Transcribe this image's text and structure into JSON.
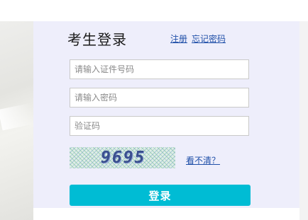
{
  "login": {
    "title": "考生登录",
    "register_link": "注册",
    "forgot_password_link": "忘记密码",
    "id_field": {
      "placeholder": "请输入证件号码",
      "value": ""
    },
    "password_field": {
      "placeholder": "请输入密码",
      "value": ""
    },
    "captcha_field": {
      "placeholder": "验证码",
      "value": ""
    },
    "captcha_image_text": "9695",
    "refresh_captcha_link": "看不清？",
    "submit_label": "登录"
  },
  "colors": {
    "panel_background": "#eeeefb",
    "link": "#1f4fa8",
    "submit_button": "#00bcd4"
  }
}
